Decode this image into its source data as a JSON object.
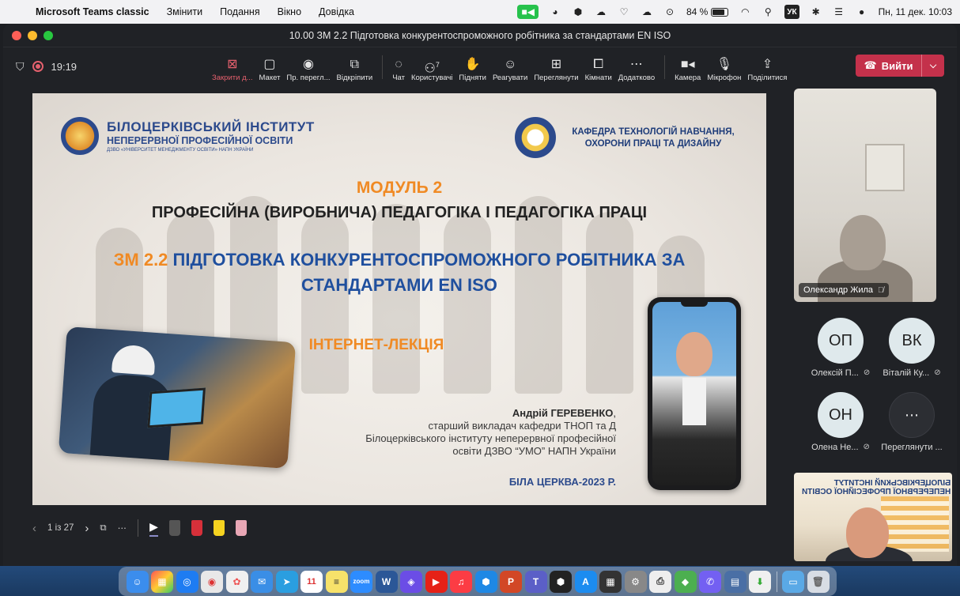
{
  "menubar": {
    "app_name": "Microsoft Teams classic",
    "items": [
      "Змінити",
      "Подання",
      "Вікно",
      "Довідка"
    ],
    "battery_percent": "84 %",
    "battery_level": 0.84,
    "keyboard_layout": "УК",
    "datetime": "Пн, 11 дек. 10:03"
  },
  "window": {
    "title": "10.00 ЗМ 2.2 Підготовка конкурентоспроможного робітника за стандартами EN ISO"
  },
  "toolbar": {
    "timer": "19:19",
    "tools": [
      {
        "label": "Закрити д...",
        "icon": "close-share-icon"
      },
      {
        "label": "Макет",
        "icon": "layout-icon"
      },
      {
        "label": "Пр. перегл...",
        "icon": "presenter-view-icon"
      },
      {
        "label": "Відкріпити",
        "icon": "pop-out-icon"
      },
      {
        "label": "Чат",
        "icon": "chat-icon"
      },
      {
        "label": "Користувачі",
        "icon": "people-icon",
        "count": "7"
      },
      {
        "label": "Підняти",
        "icon": "raise-hand-icon"
      },
      {
        "label": "Реагувати",
        "icon": "react-icon"
      },
      {
        "label": "Переглянути",
        "icon": "view-icon"
      },
      {
        "label": "Кімнати",
        "icon": "rooms-icon"
      },
      {
        "label": "Додатково",
        "icon": "more-icon"
      },
      {
        "label": "Камера",
        "icon": "camera-icon"
      },
      {
        "label": "Мікрофон",
        "icon": "microphone-icon"
      },
      {
        "label": "Поділитися",
        "icon": "share-icon"
      }
    ],
    "leave_label": "Вийти"
  },
  "slide": {
    "institute_line1": "БІЛОЦЕРКІВСЬКИЙ ІНСТИТУТ",
    "institute_line2": "НЕПЕРЕРВНОЇ ПРОФЕСІЙНОЇ ОСВІТИ",
    "institute_line3": "ДЗВО «УНІВЕРСИТЕТ МЕНЕДЖМЕНТУ ОСВІТИ» НАПН УКРАЇНИ",
    "department_line1": "КАФЕДРА ТЕХНОЛОГІЙ НАВЧАННЯ,",
    "department_line2": "ОХОРОНИ ПРАЦІ ТА ДИЗАЙНУ",
    "module": "МОДУЛЬ 2",
    "subject": "ПРОФЕСІЙНА (ВИРОБНИЧА) ПЕДАГОГІКА І ПЕДАГОГІКА ПРАЦІ",
    "topic_code": "ЗМ 2.2",
    "topic_line1": "ПІДГОТОВКА КОНКУРЕНТОСПРОМОЖНОГО РОБІТНИКА ЗА",
    "topic_line2": "СТАНДАРТАМИ EN ISO",
    "lecture_type": "ІНТЕРНЕТ-ЛЕКЦІЯ",
    "author_name": "Андрій ГЕРЕВЕНКО",
    "author_line1": "старший викладач кафедри ТНОП та Д",
    "author_line2": "Білоцерківського інституту неперервної професійної",
    "author_line3": "освіти ДЗВО “УМО” НАПН України",
    "city_year": "БІЛА ЦЕРКВА-2023 Р."
  },
  "slide_nav": {
    "page_indicator": "1 із 27"
  },
  "participants": {
    "video_name": "Олександр Жила",
    "tiles": [
      {
        "initials": "ОП",
        "name": "Олексій П..."
      },
      {
        "initials": "ВК",
        "name": "Віталій Ку..."
      },
      {
        "initials": "ОН",
        "name": "Олена Не..."
      }
    ],
    "more_label": "Переглянути ..."
  },
  "colors": {
    "teams_bg": "#202226",
    "leave_red": "#c4314b",
    "slide_orange": "#f08a24",
    "slide_blue": "#1f4f9e"
  }
}
